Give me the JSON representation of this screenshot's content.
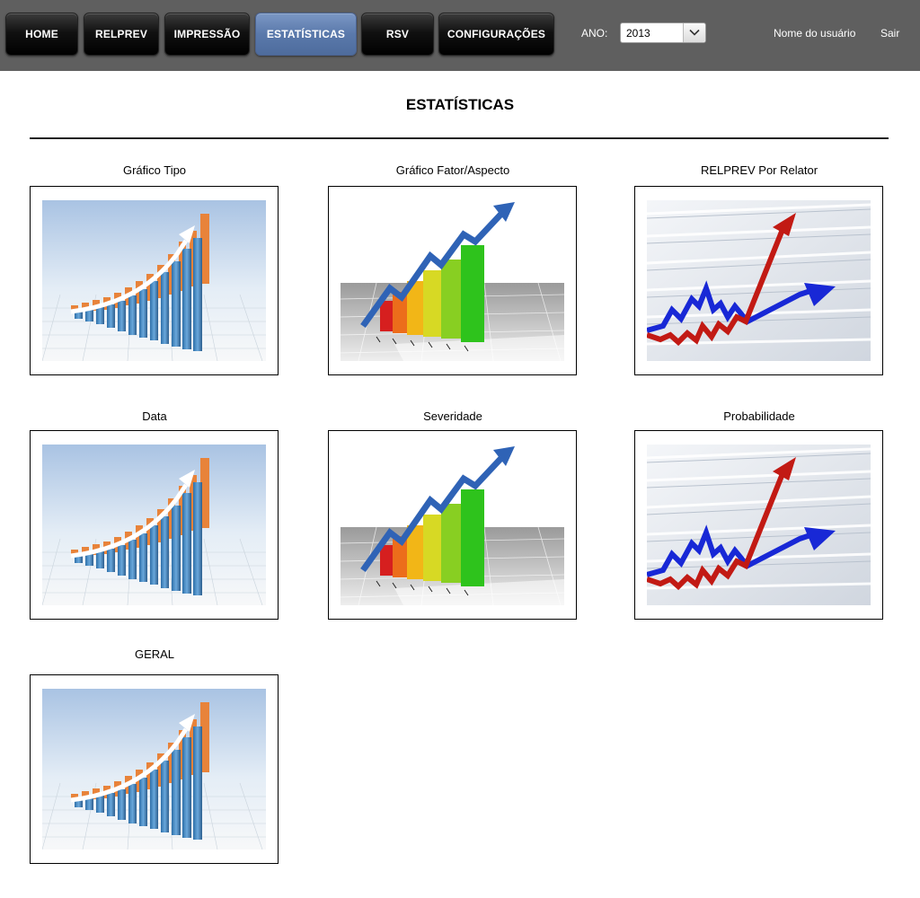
{
  "nav": {
    "items": [
      {
        "label": "HOME"
      },
      {
        "label": "RELPREV"
      },
      {
        "label": "IMPRESSÃO"
      },
      {
        "label": "ESTATÍSTICAS",
        "active": true
      },
      {
        "label": "RSV"
      },
      {
        "label": "CONFIGURAÇÕES"
      }
    ],
    "active_color": "#5a79ab"
  },
  "year": {
    "label": "ANO:",
    "value": "2013"
  },
  "user": {
    "name": "Nome do usuário",
    "logout": "Sair"
  },
  "page": {
    "title": "ESTATÍSTICAS"
  },
  "cards": [
    {
      "label": "Gráfico Tipo",
      "image": "bar-chart-rising-blue-icon"
    },
    {
      "label": "Gráfico Fator/Aspecto",
      "image": "bar-chart-colored-arrow-icon"
    },
    {
      "label": "RELPREV Por Relator",
      "image": "red-blue-arrows-chart-icon"
    },
    {
      "label": "Data",
      "image": "bar-chart-rising-blue-icon"
    },
    {
      "label": "Severidade",
      "image": "bar-chart-colored-arrow-icon"
    },
    {
      "label": "Probabilidade",
      "image": "red-blue-arrows-chart-icon"
    },
    {
      "label": "GERAL",
      "image": "bar-chart-rising-blue-icon"
    }
  ]
}
